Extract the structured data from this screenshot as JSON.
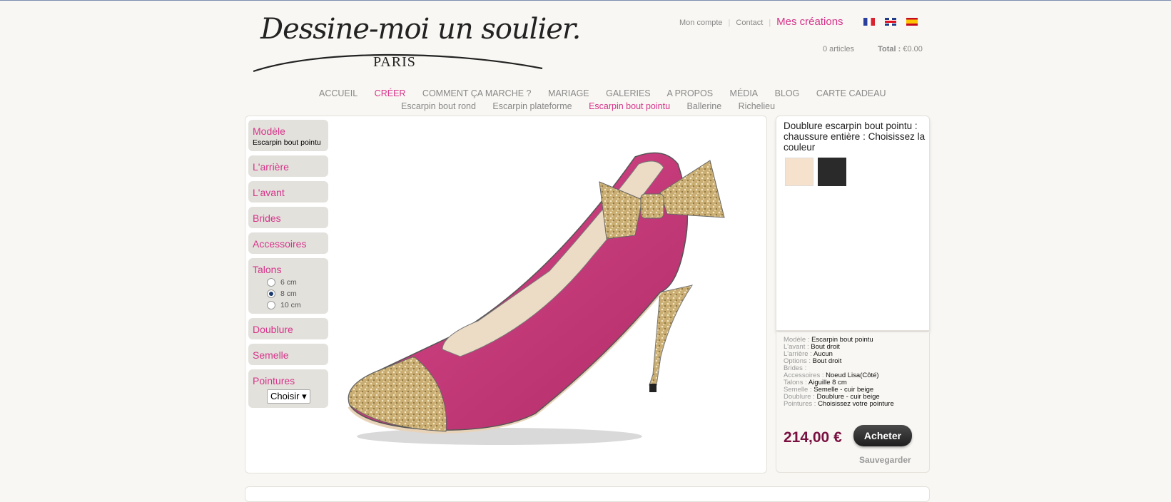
{
  "logo": {
    "script": "Dessine-moi un soulier.",
    "city": "PARIS"
  },
  "header": {
    "links": [
      "Mon compte",
      "Contact",
      "Mes créations"
    ],
    "flags": [
      "france-flag-icon",
      "uk-flag-icon",
      "spain-flag-icon"
    ],
    "cart": {
      "articles": "0 articles",
      "total_label": "Total :",
      "total_value": "€0.00"
    }
  },
  "nav": {
    "main": [
      "ACCUEIL",
      "CRÉER",
      "COMMENT ÇA MARCHE ?",
      "MARIAGE",
      "GALERIES",
      "A PROPOS",
      "MÉDIA",
      "BLOG",
      "CARTE CADEAU"
    ],
    "main_active": "CRÉER",
    "sub": [
      "Escarpin bout rond",
      "Escarpin plateforme",
      "Escarpin bout pointu",
      "Ballerine",
      "Richelieu"
    ],
    "sub_active": "Escarpin bout pointu"
  },
  "menu": {
    "modele": {
      "label": "Modèle",
      "value": "Escarpin bout pointu"
    },
    "arriere": "L'arrière",
    "avant": "L'avant",
    "brides": "Brides",
    "accessoires": "Accessoires",
    "talons": {
      "label": "Talons",
      "options": [
        "6 cm",
        "8 cm",
        "10 cm"
      ],
      "selected": "8 cm"
    },
    "doublure": "Doublure",
    "semelle": "Semelle",
    "pointures": {
      "label": "Pointures",
      "select": "Choisir"
    }
  },
  "side": {
    "title": "Doublure escarpin bout pointu : chaussure entière : Choisissez la couleur",
    "swatches": [
      {
        "name": "beige",
        "color": "#f5e1cc"
      },
      {
        "name": "noir",
        "color": "#2a2a2a"
      }
    ],
    "summary": [
      {
        "k": "Modèle :",
        "v": "Escarpin bout pointu"
      },
      {
        "k": "L'avant :",
        "v": "Bout droit"
      },
      {
        "k": "L'arrière :",
        "v": "Aucun"
      },
      {
        "k": "Options :",
        "v": "Bout droit"
      },
      {
        "k": "Brides :",
        "v": ""
      },
      {
        "k": "Accessoires :",
        "v": "Noeud Lisa(Côté)"
      },
      {
        "k": "Talons :",
        "v": "Aiguille 8 cm"
      },
      {
        "k": "Semelle :",
        "v": "Semelle - cuir beige"
      },
      {
        "k": "Doublure :",
        "v": "Doublure - cuir beige"
      },
      {
        "k": "Pointures :",
        "v": "Choisissez votre pointure"
      }
    ],
    "price": "214,00 €",
    "buy": "Acheter",
    "save": "Sauvegarder"
  },
  "colors": {
    "accent": "#d6338a",
    "price": "#7a1040",
    "shoe": "#c43a78",
    "glitter": "#c9ad72"
  }
}
